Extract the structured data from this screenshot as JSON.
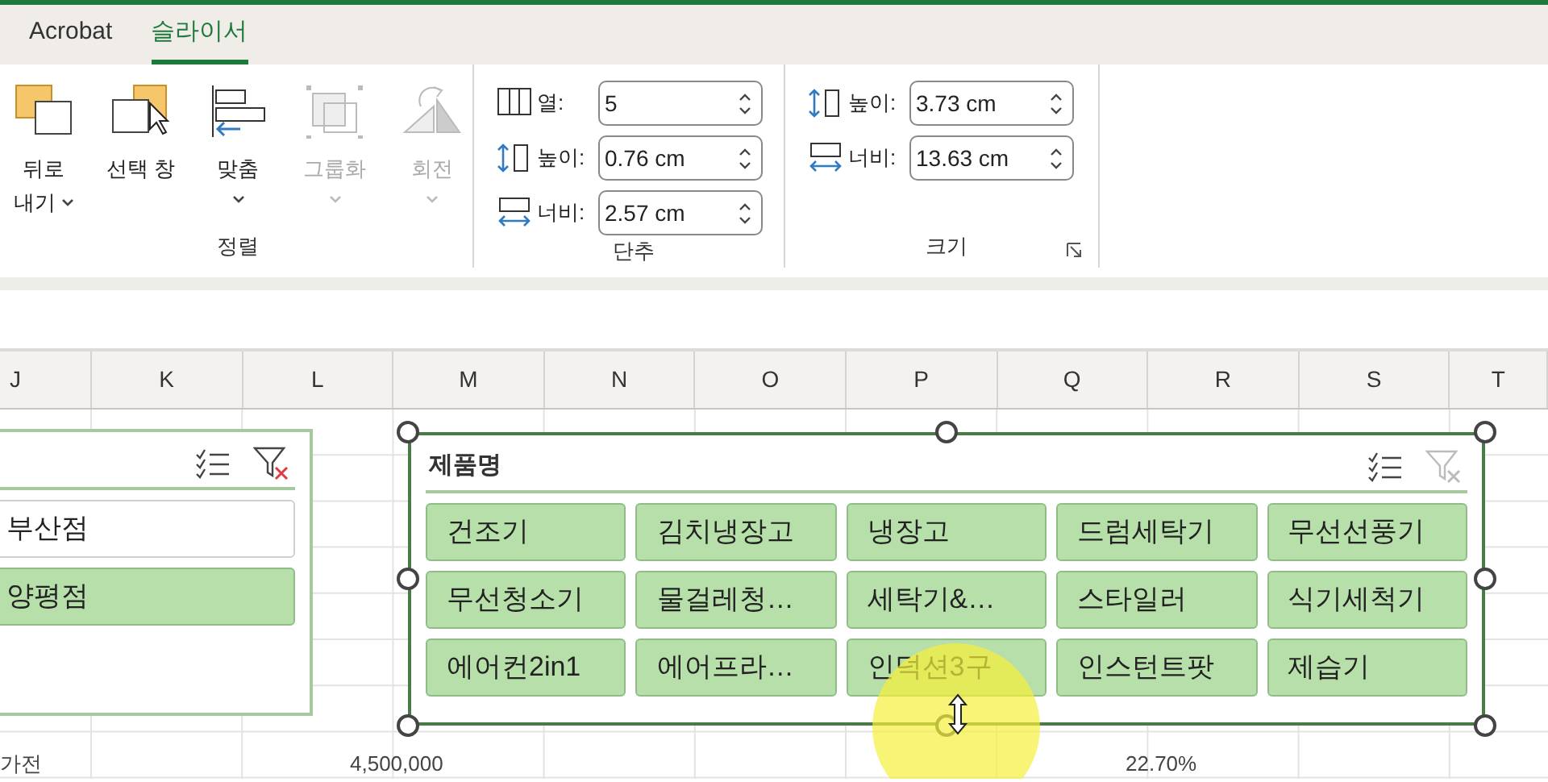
{
  "tabs": [
    {
      "label": "Acrobat",
      "selected": false
    },
    {
      "label": "슬라이서",
      "selected": true
    }
  ],
  "ribbon": {
    "groups": [
      {
        "label": "정렬",
        "buttons": [
          {
            "kind": "send_back",
            "lines": [
              "뒤로",
              "내기"
            ],
            "dropdown": true,
            "disabled": false
          },
          {
            "kind": "selection_pane",
            "lines": [
              "선택 창"
            ],
            "dropdown": false,
            "disabled": false
          },
          {
            "kind": "align",
            "lines": [
              "맞춤"
            ],
            "dropdown": true,
            "disabled": false
          },
          {
            "kind": "group",
            "lines": [
              "그룹화"
            ],
            "dropdown": true,
            "disabled": true
          },
          {
            "kind": "rotate",
            "lines": [
              "회전"
            ],
            "dropdown": true,
            "disabled": true
          }
        ]
      },
      {
        "label": "단추",
        "fields": [
          {
            "kind": "columns",
            "label": "열:",
            "value": "5"
          },
          {
            "kind": "height",
            "label": "높이:",
            "value": "0.76 cm"
          },
          {
            "kind": "width",
            "label": "너비:",
            "value": "2.57 cm"
          }
        ]
      },
      {
        "label": "크기",
        "launcher": true,
        "fields": [
          {
            "kind": "height",
            "label": "높이:",
            "value": "3.73 cm"
          },
          {
            "kind": "width",
            "label": "너비:",
            "value": "13.63 cm"
          }
        ]
      }
    ]
  },
  "columns": [
    "J",
    "K",
    "L",
    "M",
    "N",
    "O",
    "P",
    "Q",
    "R",
    "S",
    "T"
  ],
  "slicers": [
    {
      "clear_filter_enabled": true,
      "handles": false,
      "items": [
        {
          "label": "부산점",
          "selected": false
        },
        {
          "label": "양평점",
          "selected": true
        }
      ]
    },
    {
      "title": "제품명",
      "clear_filter_enabled": false,
      "handles": true,
      "items": [
        {
          "label": "건조기",
          "selected": true
        },
        {
          "label": "김치냉장고",
          "selected": true
        },
        {
          "label": "냉장고",
          "selected": true
        },
        {
          "label": "드럼세탁기",
          "selected": true
        },
        {
          "label": "무선선풍기",
          "selected": true
        },
        {
          "label": "무선청소기",
          "selected": true
        },
        {
          "label": "물걸레청…",
          "selected": true
        },
        {
          "label": "세탁기&…",
          "selected": true
        },
        {
          "label": "스타일러",
          "selected": true
        },
        {
          "label": "식기세척기",
          "selected": true
        },
        {
          "label": "에어컨2in1",
          "selected": true
        },
        {
          "label": "에어프라…",
          "selected": true
        },
        {
          "label": "인덕션3구",
          "selected": true
        },
        {
          "label": "인스턴트팟",
          "selected": true
        },
        {
          "label": "제습기",
          "selected": true
        }
      ]
    }
  ],
  "bottom_row": [
    "가전",
    "4,500,000",
    "22.70%"
  ]
}
